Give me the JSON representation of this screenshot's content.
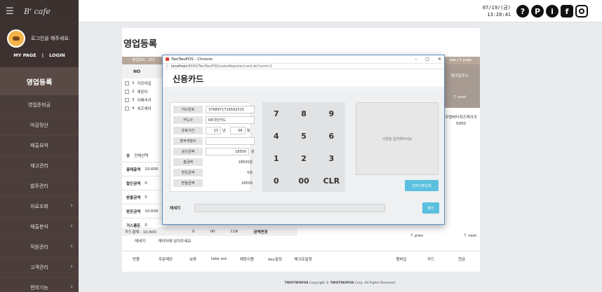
{
  "app": {
    "logo": "B' cafe",
    "datetime_line1": "07/19/(금)",
    "datetime_line2": "13:20:41"
  },
  "top_icons": [
    {
      "name": "help-icon",
      "glyph": "?"
    },
    {
      "name": "pos-icon",
      "glyph": "P"
    },
    {
      "name": "info-icon",
      "glyph": "i"
    },
    {
      "name": "facebook-icon",
      "glyph": "f"
    },
    {
      "name": "instagram-icon",
      "glyph": ""
    }
  ],
  "sidebar": {
    "login_message": "로그인을 해주세요.",
    "my_page": "MY PAGE",
    "separator": "|",
    "login": "LOGIN",
    "title": "영업등록",
    "items": [
      {
        "label": "영업준비금",
        "chevron": false
      },
      {
        "label": "마감정산",
        "chevron": false
      },
      {
        "label": "매출요약",
        "chevron": false
      },
      {
        "label": "재고관리",
        "chevron": false
      },
      {
        "label": "발주관리",
        "chevron": false
      },
      {
        "label": "자료조회",
        "chevron": true
      },
      {
        "label": "매출분석",
        "chevron": true
      },
      {
        "label": "직원관리",
        "chevron": true
      },
      {
        "label": "고객관리",
        "chevron": true
      },
      {
        "label": "편의기능",
        "chevron": true
      }
    ]
  },
  "main": {
    "title": "영업등록",
    "info_left": "영업일자 : 201",
    "info_right": "age / 1 page",
    "col_no": "NO",
    "col_right": "생과일주스",
    "rows": [
      {
        "no": "1",
        "name": "카모마일"
      },
      {
        "no": "2",
        "name": "레몬티"
      },
      {
        "no": "3",
        "name": "아메리카"
      },
      {
        "no": "4",
        "name": "치즈케이"
      }
    ],
    "next_label": "↑ next",
    "item_right_name": "무염버터치즈케이크",
    "item_right_price": "5000",
    "summary": [
      {
        "label": "송",
        "value": "전체선택"
      },
      {
        "label": "총매출액",
        "value": "10,600"
      },
      {
        "label": "할인금액",
        "value": "0"
      },
      {
        "label": "받을금액",
        "value": "0"
      },
      {
        "label": "받은금액",
        "value": "10,600"
      },
      {
        "label": "거스름돈",
        "value": "0"
      }
    ],
    "card_total": "카드결제 : 10,600",
    "strip_keys": [
      "0",
      "00",
      "CLR",
      "금액변경"
    ],
    "msg_label": "메세지",
    "msg_text": "캐리어에 담아주세요",
    "prev": "↑ prev",
    "next": "↑ next"
  },
  "bottom_bar": [
    "반품",
    "주문메모",
    "보류",
    "take out",
    "매장이용",
    "key설정",
    "메크로설정",
    "",
    "",
    "멤버십",
    "카드",
    "현금"
  ],
  "footer": {
    "brand": "TWOTWOPOS",
    "text": " Copyright © ",
    "brand2": "TWOTWOPOS",
    "rest": " Corp. All Rights Reserved."
  },
  "popup": {
    "window_title": "TwoTwoPOS - Chrome",
    "win_min": "–",
    "win_max": "▢",
    "win_close": "✕",
    "address_host": "localhost",
    "address_path": ":8090/TwoTwoPOS/salesRegister/card.do?card=1",
    "title": "신용카드",
    "fields": {
      "card_no_label": "카드번호",
      "card_no": "3768971716592525",
      "card_co_label": "카드사",
      "card_co": "KB국민카드",
      "expiry_label": "유효기간",
      "expiry_year": "23",
      "year_unit": "년",
      "expiry_month": "06",
      "month_unit": "월",
      "installment_label": "할부개월수",
      "installment": "",
      "approve_label": "승인금액",
      "approve": "18500",
      "approve_unit": "원",
      "total_label": "총금액",
      "total": "18500원",
      "received_label": "받은금액",
      "received": "0원",
      "to_receive_label": "받을금액",
      "to_receive": "18500"
    },
    "keys": [
      "7",
      "8",
      "9",
      "4",
      "5",
      "6",
      "1",
      "2",
      "3",
      "0",
      "00",
      "CLR"
    ],
    "signature_placeholder": "서명을 입력해주세요",
    "sign_button": "전자서명입력",
    "message_label": "메세지",
    "confirm_button": "확인"
  }
}
